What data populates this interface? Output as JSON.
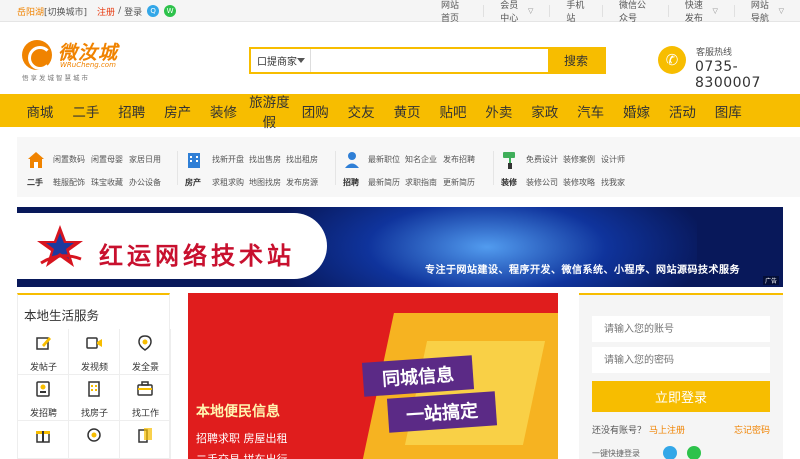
{
  "topbar": {
    "site": "岳阳湖",
    "switch_city": "[切换城市]",
    "register": "注册",
    "sep": "/",
    "login": "登录",
    "links": [
      {
        "label": "网站首页",
        "caret": false
      },
      {
        "label": "会员中心",
        "caret": true
      },
      {
        "label": "手机站",
        "caret": false
      },
      {
        "label": "微信公众号",
        "caret": false
      },
      {
        "label": "快速发布",
        "caret": true
      },
      {
        "label": "网站导航",
        "caret": true
      }
    ]
  },
  "logo": {
    "name": "微汝城",
    "en": "WRuCheng.com",
    "slogan": "悟享发城智慧城市"
  },
  "search": {
    "category": "口提商家",
    "placeholder": "",
    "button": "搜索"
  },
  "hotline": {
    "label": "客服热线",
    "number": "0735-8300007"
  },
  "nav": [
    "商城",
    "二手",
    "招聘",
    "房产",
    "装修",
    "旅游度假",
    "团购",
    "交友",
    "黄页",
    "贴吧",
    "外卖",
    "家政",
    "汽车",
    "婚嫁",
    "活动",
    "图库"
  ],
  "categories": [
    {
      "label": "二手",
      "icon": "house-icon",
      "color": "#f08300",
      "row1": [
        "闲置数码",
        "闲置母婴",
        "家居日用"
      ],
      "row2": [
        "鞋服配饰",
        "珠宝收藏",
        "办公设备"
      ]
    },
    {
      "label": "房产",
      "icon": "building-icon",
      "color": "#2f7fd6",
      "row1": [
        "找新开盘",
        "找出售房",
        "找出租房"
      ],
      "row2": [
        "求租求购",
        "地图找房",
        "发布房源"
      ]
    },
    {
      "label": "招聘",
      "icon": "person-icon",
      "color": "#2f7fd6",
      "row1": [
        "最新职位",
        "知名企业",
        "发布招聘"
      ],
      "row2": [
        "最新简历",
        "求职指南",
        "更新简历"
      ]
    },
    {
      "label": "装修",
      "icon": "paint-roller-icon",
      "color": "#3fae5a",
      "row1": [
        "免费设计",
        "装修案例",
        "设计师"
      ],
      "row2": [
        "装修公司",
        "装修攻略",
        "找我家"
      ]
    }
  ],
  "banner": {
    "title": "红运网络技术站",
    "subtitle": "专注于网站建设、程序开发、微信系统、小程序、网站源码技术服务",
    "ad": "广告"
  },
  "local": {
    "title": "本地生活服务",
    "items": [
      {
        "label": "发帖子",
        "icon": "edit-icon"
      },
      {
        "label": "发视频",
        "icon": "video-icon"
      },
      {
        "label": "发全景",
        "icon": "location-icon"
      },
      {
        "label": "发招聘",
        "icon": "badge-icon"
      },
      {
        "label": "找房子",
        "icon": "building-icon"
      },
      {
        "label": "找工作",
        "icon": "briefcase-icon"
      },
      {
        "label": "",
        "icon": "gift-icon"
      },
      {
        "label": "",
        "icon": "camera-icon"
      },
      {
        "label": "",
        "icon": "document-icon"
      }
    ]
  },
  "promo": {
    "line1": "本地便民信息",
    "line2": "招聘求职  房屋出租",
    "line3": "二手交易  拼车出行",
    "banner1": "同城信息",
    "banner2": "一站搞定"
  },
  "login": {
    "account_placeholder": "请输入您的账号",
    "password_placeholder": "请输入您的密码",
    "button": "立即登录",
    "no_account": "还没有账号？",
    "register": "马上注册",
    "forgot": "忘记密码",
    "quick": "一键快捷登录"
  },
  "colors": {
    "accent": "#f7bd00",
    "brand": "#f08300",
    "promo_red": "#e01d1d"
  }
}
